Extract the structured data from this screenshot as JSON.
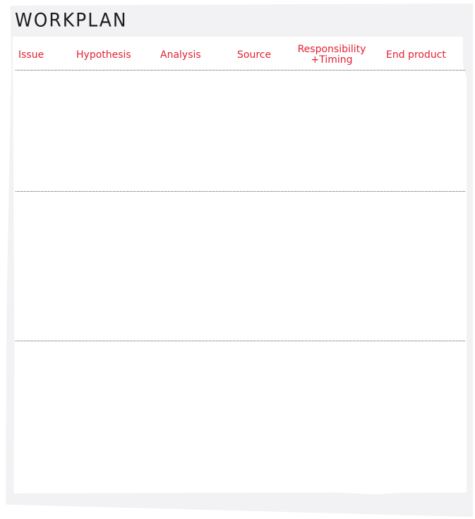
{
  "title": "WORKPLAN",
  "colors": {
    "header_text": "#e31f30",
    "title_text": "#1c1c1c",
    "sheet_background": "#f2f2f4",
    "panel_background": "#ffffff",
    "divider": "#555555"
  },
  "columns": [
    {
      "label": "Issue"
    },
    {
      "label": "Hypothesis"
    },
    {
      "label": "Analysis"
    },
    {
      "label": "Source"
    },
    {
      "label_line1": "Responsibility",
      "label_line2": "+Timing"
    },
    {
      "label": "End product"
    }
  ],
  "rows": [
    {
      "issue": "",
      "hypothesis": "",
      "analysis": "",
      "source": "",
      "responsibility_timing": "",
      "end_product": ""
    },
    {
      "issue": "",
      "hypothesis": "",
      "analysis": "",
      "source": "",
      "responsibility_timing": "",
      "end_product": ""
    },
    {
      "issue": "",
      "hypothesis": "",
      "analysis": "",
      "source": "",
      "responsibility_timing": "",
      "end_product": ""
    }
  ]
}
